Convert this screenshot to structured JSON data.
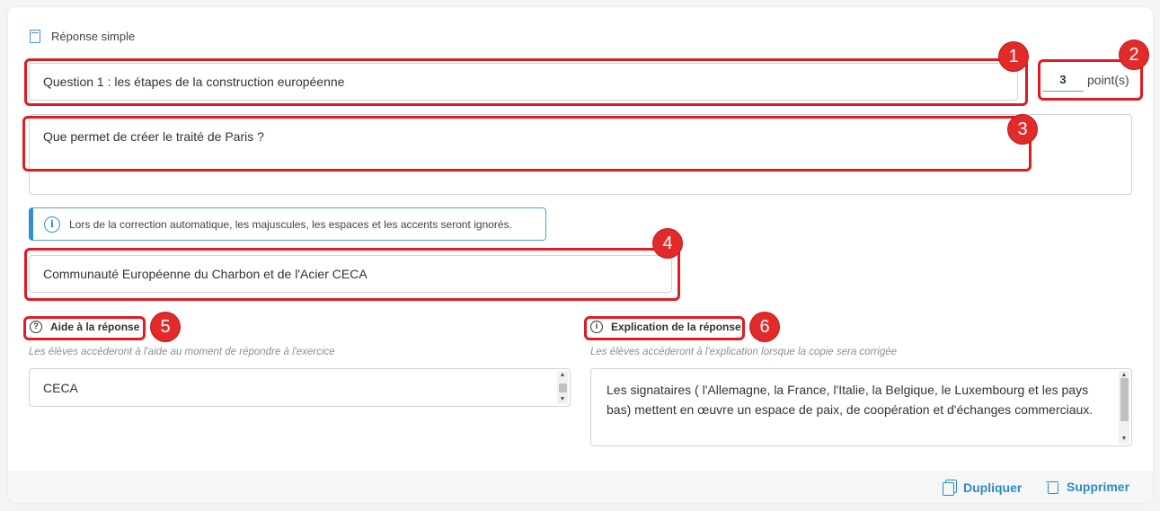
{
  "question_type": "Réponse simple",
  "question": {
    "title": "Question 1 : les étapes de la construction européenne",
    "points_value": "3",
    "points_label": "point(s)",
    "statement": "Que permet de créer le traité de Paris ?"
  },
  "info_notice": "Lors de la correction automatique, les majuscules, les espaces et les accents seront ignorés.",
  "answer": "Communauté Européenne du Charbon et de l'Acier CECA",
  "help": {
    "label": "Aide à la réponse",
    "hint": "Les élèves accéderont à l'aide au moment de répondre à l'exercice",
    "value": "CECA"
  },
  "explanation": {
    "label": "Explication de la réponse",
    "hint": "Les élèves accéderont à l'explication lorsque la copie sera corrigée",
    "value": "Les signataires ( l'Allemagne, la France, l'Italie, la Belgique, le Luxembourg et les pays bas) mettent en œuvre un espace de paix, de coopération et d'échanges commerciaux."
  },
  "actions": {
    "duplicate": "Dupliquer",
    "delete": "Supprimer"
  },
  "annotations": {
    "badge1": "1",
    "badge2": "2",
    "badge3": "3",
    "badge4": "4",
    "badge5": "5",
    "badge6": "6",
    "highlight_color": "#e01b24"
  },
  "colors": {
    "accent": "#2e8bc0",
    "info_border": "#2f8fcc",
    "points_underline": "#5cb85c"
  }
}
